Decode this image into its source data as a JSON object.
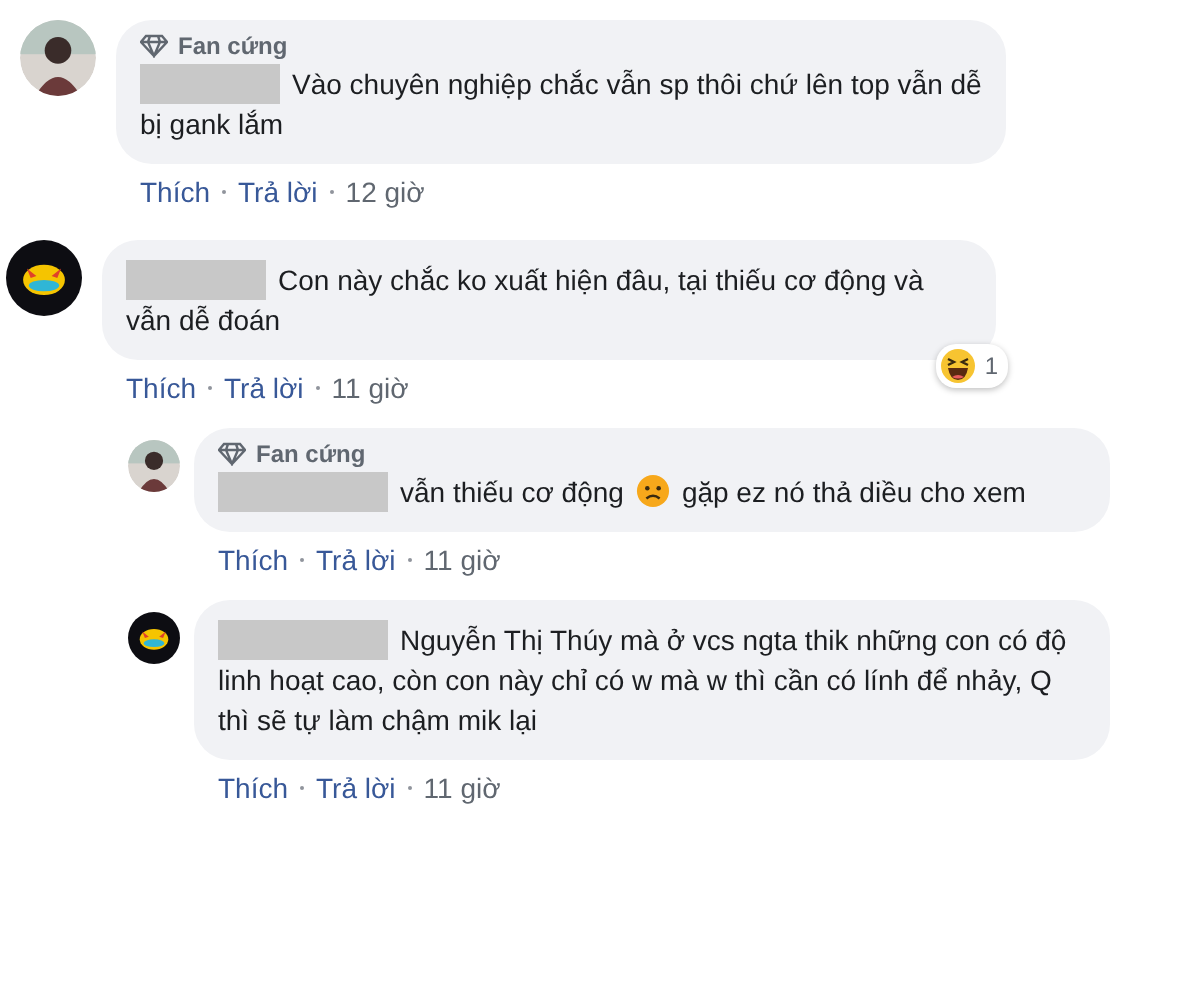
{
  "comments": [
    {
      "avatar": {
        "kind": "photo"
      },
      "badge": "Fan cứng",
      "redacted_name": true,
      "segments": [
        {
          "kind": "text",
          "text": "Vào chuyên nghiệp chắc vẫn sp thôi chứ lên top vẫn dễ bị gank lắm"
        }
      ],
      "actions": [
        "Thích",
        "Trả lời"
      ],
      "time": "12 giờ"
    },
    {
      "avatar": {
        "kind": "emblem"
      },
      "redacted_name": true,
      "segments": [
        {
          "kind": "text",
          "text": "Con này chắc ko xuất hiện đâu, tại thiếu cơ động và vẫn dễ đoán"
        }
      ],
      "reaction": {
        "kind": "haha",
        "count": "1"
      },
      "actions": [
        "Thích",
        "Trả lời"
      ],
      "time": "11 giờ",
      "children": [
        {
          "avatar": {
            "kind": "photo"
          },
          "badge": "Fan cứng",
          "redacted_name": true,
          "segments": [
            {
              "kind": "text",
              "text": "vẫn thiếu cơ động"
            },
            {
              "kind": "emoji"
            },
            {
              "kind": "text",
              "text": "gặp ez nó thả diều cho xem"
            }
          ],
          "actions": [
            "Thích",
            "Trả lời"
          ],
          "time": "11 giờ"
        },
        {
          "avatar": {
            "kind": "emblem"
          },
          "redacted_name": true,
          "segments": [
            {
              "kind": "text",
              "text": "Nguyễn Thị Thúy mà ở vcs ngta thik những con có độ linh hoạt cao, còn con này chỉ có w mà w thì cần có lính để nhảy, Q thì sẽ tự làm chậm mik lại"
            }
          ],
          "actions": [
            "Thích",
            "Trả lời"
          ],
          "time": "11 giờ"
        }
      ]
    }
  ]
}
